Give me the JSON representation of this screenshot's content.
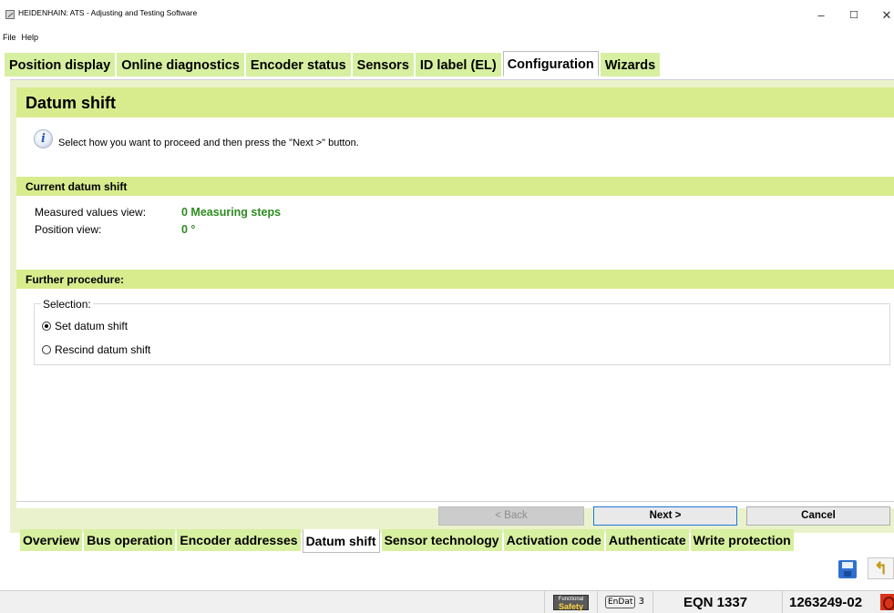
{
  "window": {
    "title": "HEIDENHAIN: ATS - Adjusting and Testing Software",
    "minimize": "–",
    "maximize": "☐",
    "close": "✕"
  },
  "menu": [
    "File",
    "Help"
  ],
  "top_tabs": [
    {
      "label": "Position display",
      "active": false
    },
    {
      "label": "Online diagnostics",
      "active": false
    },
    {
      "label": "Encoder status",
      "active": false
    },
    {
      "label": "Sensors",
      "active": false
    },
    {
      "label": "ID label (EL)",
      "active": false
    },
    {
      "label": "Configuration",
      "active": true
    },
    {
      "label": "Wizards",
      "active": false
    }
  ],
  "page": {
    "heading": "Datum shift",
    "info_icon": "info-icon",
    "info_text": "Select how you want to proceed and then press the \"Next >\" button.",
    "current_section": {
      "title": "Current datum shift",
      "measured_label": "Measured values view:",
      "measured_value": "0 Measuring steps",
      "position_label": "Position view:",
      "position_value": "0 °"
    },
    "further_section": {
      "title": "Further procedure:",
      "selection_legend": "Selection:",
      "options": [
        {
          "label": "Set datum shift",
          "checked": true
        },
        {
          "label": "Rescind datum shift",
          "checked": false
        }
      ]
    }
  },
  "wizard_buttons": {
    "back": "< Back",
    "next": "Next >",
    "cancel": "Cancel"
  },
  "bottom_tabs": [
    {
      "label": "Overview",
      "active": false
    },
    {
      "label": "Bus operation",
      "active": false
    },
    {
      "label": "Encoder addresses",
      "active": false
    },
    {
      "label": "Datum shift",
      "active": true
    },
    {
      "label": "Sensor technology",
      "active": false
    },
    {
      "label": "Activation code",
      "active": false
    },
    {
      "label": "Authenticate",
      "active": false
    },
    {
      "label": "Write protection",
      "active": false
    }
  ],
  "toolbar": {
    "save_icon": "save-icon",
    "undo_icon": "undo-icon",
    "undo_glyph": "↰"
  },
  "statusbar": {
    "functional_safety_top": "Functional",
    "functional_safety_bottom": "Safety",
    "endat_label": "EnDat",
    "endat_version": "3",
    "model": "EQN 1337",
    "id_number": "1263249-02"
  },
  "colors": {
    "tab_green": "#d7efa0",
    "heading_green": "#d8ec8e",
    "value_green": "#2d8b1f",
    "panel_bg": "#e9f2cc",
    "next_border": "#1f76d8"
  }
}
